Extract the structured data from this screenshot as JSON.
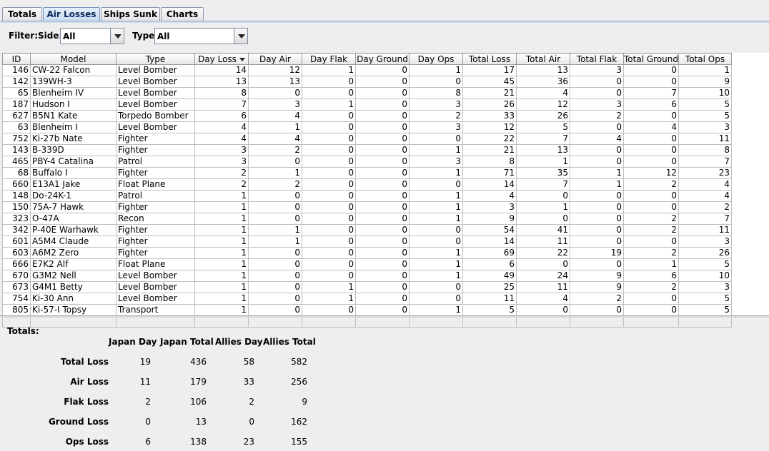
{
  "tabs": [
    {
      "label": "Totals",
      "active": false
    },
    {
      "label": "Air Losses",
      "active": true
    },
    {
      "label": "Ships Sunk",
      "active": false
    },
    {
      "label": "Charts",
      "active": false
    }
  ],
  "filter": {
    "label": "Filter:",
    "side_label": "Side:",
    "side_value": "All",
    "type_label": "Type:",
    "type_value": "All"
  },
  "table": {
    "columns": [
      "ID",
      "Model",
      "Type",
      "Day Loss",
      "Day Air",
      "Day Flak",
      "Day Ground",
      "Day Ops",
      "Total Loss",
      "Total Air",
      "Total Flak",
      "Total Ground",
      "Total Ops"
    ],
    "sorted_column": "Day Loss",
    "rows": [
      [
        "146",
        "CW-22 Falcon",
        "Level Bomber",
        "14",
        "12",
        "1",
        "0",
        "1",
        "17",
        "13",
        "3",
        "0",
        "1"
      ],
      [
        "142",
        "139WH-3",
        "Level Bomber",
        "13",
        "13",
        "0",
        "0",
        "0",
        "45",
        "36",
        "0",
        "0",
        "9"
      ],
      [
        "65",
        "Blenheim IV",
        "Level Bomber",
        "8",
        "0",
        "0",
        "0",
        "8",
        "21",
        "4",
        "0",
        "7",
        "10"
      ],
      [
        "187",
        "Hudson I",
        "Level Bomber",
        "7",
        "3",
        "1",
        "0",
        "3",
        "26",
        "12",
        "3",
        "6",
        "5"
      ],
      [
        "627",
        "B5N1 Kate",
        "Torpedo Bomber",
        "6",
        "4",
        "0",
        "0",
        "2",
        "33",
        "26",
        "2",
        "0",
        "5"
      ],
      [
        "63",
        "Blenheim I",
        "Level Bomber",
        "4",
        "1",
        "0",
        "0",
        "3",
        "12",
        "5",
        "0",
        "4",
        "3"
      ],
      [
        "752",
        "Ki-27b Nate",
        "Fighter",
        "4",
        "4",
        "0",
        "0",
        "0",
        "22",
        "7",
        "4",
        "0",
        "11"
      ],
      [
        "143",
        "B-339D",
        "Fighter",
        "3",
        "2",
        "0",
        "0",
        "1",
        "21",
        "13",
        "0",
        "0",
        "8"
      ],
      [
        "465",
        "PBY-4 Catalina",
        "Patrol",
        "3",
        "0",
        "0",
        "0",
        "3",
        "8",
        "1",
        "0",
        "0",
        "7"
      ],
      [
        "68",
        "Buffalo I",
        "Fighter",
        "2",
        "1",
        "0",
        "0",
        "1",
        "71",
        "35",
        "1",
        "12",
        "23"
      ],
      [
        "660",
        "E13A1 Jake",
        "Float Plane",
        "2",
        "2",
        "0",
        "0",
        "0",
        "14",
        "7",
        "1",
        "2",
        "4"
      ],
      [
        "148",
        "Do-24K-1",
        "Patrol",
        "1",
        "0",
        "0",
        "0",
        "1",
        "4",
        "0",
        "0",
        "0",
        "4"
      ],
      [
        "150",
        "75A-7 Hawk",
        "Fighter",
        "1",
        "0",
        "0",
        "0",
        "1",
        "3",
        "1",
        "0",
        "0",
        "2"
      ],
      [
        "323",
        "O-47A",
        "Recon",
        "1",
        "0",
        "0",
        "0",
        "1",
        "9",
        "0",
        "0",
        "2",
        "7"
      ],
      [
        "342",
        "P-40E Warhawk",
        "Fighter",
        "1",
        "1",
        "0",
        "0",
        "0",
        "54",
        "41",
        "0",
        "2",
        "11"
      ],
      [
        "601",
        "A5M4 Claude",
        "Fighter",
        "1",
        "1",
        "0",
        "0",
        "0",
        "14",
        "11",
        "0",
        "0",
        "3"
      ],
      [
        "603",
        "A6M2 Zero",
        "Fighter",
        "1",
        "0",
        "0",
        "0",
        "1",
        "69",
        "22",
        "19",
        "2",
        "26"
      ],
      [
        "666",
        "E7K2 Alf",
        "Float Plane",
        "1",
        "0",
        "0",
        "0",
        "1",
        "6",
        "0",
        "0",
        "1",
        "5"
      ],
      [
        "670",
        "G3M2 Nell",
        "Level Bomber",
        "1",
        "0",
        "0",
        "0",
        "1",
        "49",
        "24",
        "9",
        "6",
        "10"
      ],
      [
        "673",
        "G4M1 Betty",
        "Level Bomber",
        "1",
        "0",
        "1",
        "0",
        "0",
        "25",
        "11",
        "9",
        "2",
        "3"
      ],
      [
        "754",
        "Ki-30 Ann",
        "Level Bomber",
        "1",
        "0",
        "1",
        "0",
        "0",
        "11",
        "4",
        "2",
        "0",
        "5"
      ],
      [
        "805",
        "Ki-57-I Topsy",
        "Transport",
        "1",
        "0",
        "0",
        "0",
        "1",
        "5",
        "0",
        "0",
        "0",
        "5"
      ]
    ]
  },
  "totals": {
    "title": "Totals:",
    "headers": [
      "Japan Day",
      "Japan Total",
      "Allies Day",
      "Allies Total"
    ],
    "rows": [
      {
        "label": "Total Loss",
        "values": [
          "19",
          "436",
          "58",
          "582"
        ]
      },
      {
        "label": "Air Loss",
        "values": [
          "11",
          "179",
          "33",
          "256"
        ]
      },
      {
        "label": "Flak Loss",
        "values": [
          "2",
          "106",
          "2",
          "9"
        ]
      },
      {
        "label": "Ground Loss",
        "values": [
          "0",
          "13",
          "0",
          "162"
        ]
      },
      {
        "label": "Ops Loss",
        "values": [
          "6",
          "138",
          "23",
          "155"
        ]
      }
    ]
  }
}
